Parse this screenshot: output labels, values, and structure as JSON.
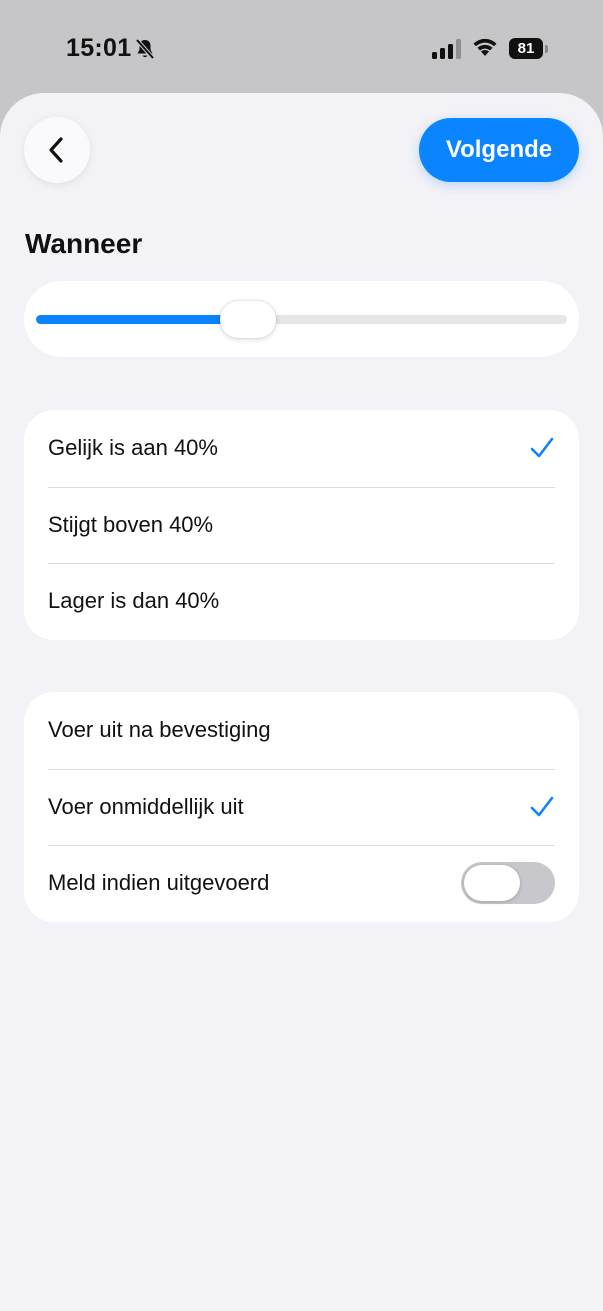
{
  "status_bar": {
    "time": "15:01",
    "battery": "81"
  },
  "header": {
    "back_icon": "chevron-left-icon",
    "next_label": "Volgende"
  },
  "section": {
    "title": "Wanneer"
  },
  "slider": {
    "value_fraction": 0.4
  },
  "condition_options": [
    {
      "label": "Gelijk is aan 40%",
      "selected": true
    },
    {
      "label": "Stijgt boven 40%",
      "selected": false
    },
    {
      "label": "Lager is dan 40%",
      "selected": false
    }
  ],
  "execution_options": {
    "confirm": {
      "label": "Voer uit na bevestiging",
      "selected": false
    },
    "immediate": {
      "label": "Voer onmiddellijk uit",
      "selected": true
    },
    "notify": {
      "label": "Meld indien uitgevoerd",
      "on": false
    }
  },
  "colors": {
    "accent": "#0a84ff",
    "background": "#f2f2f7",
    "card": "#ffffff"
  }
}
